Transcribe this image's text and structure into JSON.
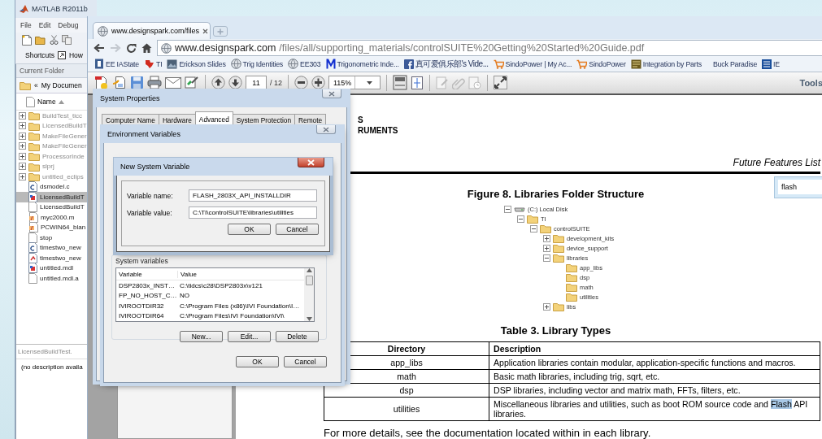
{
  "matlab": {
    "title": "MATLAB R2011b",
    "menu": [
      "File",
      "Edit",
      "Debug"
    ],
    "shortcuts": [
      "Shortcuts",
      "How"
    ],
    "panel_title": "Current Folder",
    "path_prefix": "«",
    "path": "My Documen",
    "name_column": "Name",
    "files": [
      {
        "name": "BuildTest_ticc",
        "kind": "folder",
        "expanded": false,
        "selected": false
      },
      {
        "name": "LicensedBuildT",
        "kind": "folder",
        "expanded": false,
        "selected": false
      },
      {
        "name": "MakeFileGener",
        "kind": "folder",
        "expanded": false,
        "selected": false
      },
      {
        "name": "MakeFileGener",
        "kind": "folder",
        "expanded": false,
        "selected": false
      },
      {
        "name": "ProcessorInde",
        "kind": "folder",
        "expanded": false,
        "selected": false
      },
      {
        "name": "slprj",
        "kind": "folder",
        "expanded": false,
        "selected": false
      },
      {
        "name": "untitled_eclips",
        "kind": "folder",
        "expanded": false,
        "selected": false
      },
      {
        "name": "dsmodel.c",
        "kind": "c",
        "selected": false
      },
      {
        "name": "LicensedBuildT",
        "kind": "model",
        "selected": true
      },
      {
        "name": "LicensedBuildT",
        "kind": "plain",
        "selected": false
      },
      {
        "name": "myc2000.m",
        "kind": "function",
        "selected": false
      },
      {
        "name": "PCWIN64_blan",
        "kind": "function",
        "selected": false
      },
      {
        "name": "stop",
        "kind": "plain",
        "selected": false
      },
      {
        "name": "timestwo_new",
        "kind": "c",
        "selected": false
      },
      {
        "name": "timestwo_new",
        "kind": "mex",
        "selected": false
      },
      {
        "name": "untitled.mdl",
        "kind": "model",
        "selected": false
      },
      {
        "name": "untitled.mdl.a",
        "kind": "plain",
        "selected": false
      }
    ],
    "details_title": "LicensedBuildTest.",
    "details_text": "(no description availa"
  },
  "browser": {
    "tab": {
      "title": "www.designspark.com/files",
      "selected": true
    },
    "address": {
      "domain": "www.designspark.com",
      "path": "/files/all/supporting_materials/controlSUITE%20Getting%20Started%20Guide.pdf"
    },
    "bookmarks": [
      {
        "label": "EE IAState",
        "kind": "site"
      },
      {
        "label": "TI",
        "kind": "ti"
      },
      {
        "label": "Erickson Slides",
        "kind": "photo"
      },
      {
        "label": "Trig Identities",
        "kind": "globe"
      },
      {
        "label": "EE303",
        "kind": "globe"
      },
      {
        "label": "Trigonometric Inde...",
        "kind": "m"
      },
      {
        "label": "真可爱俱乐部's Vide...",
        "kind": "facebook"
      },
      {
        "label": "SindoPower | My Ac...",
        "kind": "cart"
      },
      {
        "label": "SindoPower",
        "kind": "cart"
      },
      {
        "label": "Integration by Parts",
        "kind": "book"
      },
      {
        "label": "Buck Paradise",
        "kind": "none"
      },
      {
        "label": "IE",
        "kind": "ieee"
      }
    ],
    "pdf": {
      "page": "11",
      "page_count": "/ 12",
      "zoom": "115%",
      "tools": "Tools",
      "search": "flash",
      "page_header": [
        "S",
        "RUMENTS"
      ],
      "running_title": "Future Features List",
      "figure_title": "Figure 8. Libraries Folder Structure",
      "tree": [
        {
          "label": "(C:) Local Disk",
          "kind": "drive",
          "expanded": true,
          "children": [
            {
              "label": "TI",
              "kind": "folder",
              "expanded": true,
              "children": [
                {
                  "label": "controlSUITE",
                  "kind": "folder",
                  "expanded": true,
                  "children": [
                    {
                      "label": "development_kits",
                      "kind": "folder",
                      "expanded": false
                    },
                    {
                      "label": "device_support",
                      "kind": "folder",
                      "expanded": false
                    },
                    {
                      "label": "libraries",
                      "kind": "folder",
                      "expanded": true,
                      "children": [
                        {
                          "label": "app_libs",
                          "kind": "folder"
                        },
                        {
                          "label": "dsp",
                          "kind": "folder"
                        },
                        {
                          "label": "math",
                          "kind": "folder"
                        },
                        {
                          "label": "utilities",
                          "kind": "folder"
                        }
                      ]
                    },
                    {
                      "label": "libs",
                      "kind": "folder",
                      "expanded": false
                    }
                  ]
                }
              ]
            }
          ]
        }
      ],
      "table_title": "Table 3. Library Types",
      "table": {
        "columns": [
          "Directory",
          "Description"
        ],
        "rows": [
          {
            "directory": "app_libs",
            "description": "Application libraries contain modular, application-specific functions and macros."
          },
          {
            "directory": "math",
            "description": "Basic math libraries, including trig, sqrt, etc."
          },
          {
            "directory": "dsp",
            "description": "DSP libraries, including vector and matrix math, FFTs, filters, etc."
          },
          {
            "directory": "utilities",
            "description": "Miscellaneous libraries and utilities, such as boot ROM source code and ",
            "highlight": "Flash",
            "description_end": " API libraries."
          }
        ]
      },
      "footer_text": "For more details, see the documentation located within in each library."
    }
  },
  "system_properties": {
    "title": "System Properties",
    "tabs": [
      {
        "label": "Computer Name",
        "selected": false
      },
      {
        "label": "Hardware",
        "selected": false
      },
      {
        "label": "Advanced",
        "selected": true
      },
      {
        "label": "System Protection",
        "selected": false
      },
      {
        "label": "Remote",
        "selected": false
      }
    ]
  },
  "environment_variables": {
    "title": "Environment Variables",
    "group": "System variables",
    "columns": [
      "Variable",
      "Value"
    ],
    "rows": [
      {
        "variable": "DSP2803x_INST…",
        "value": "C:\\tidcs\\c28\\DSP2803x\\v121"
      },
      {
        "variable": "FP_NO_HOST_C…",
        "value": "NO"
      },
      {
        "variable": "IVIROOTDIR32",
        "value": "C:\\Program Files (x86)\\IVI Foundation\\I…"
      },
      {
        "variable": "IVIROOTDIR64",
        "value": "C:\\Program Files\\IVI Foundation\\IVI\\"
      }
    ],
    "list_buttons": [
      "New...",
      "Edit...",
      "Delete"
    ],
    "buttons": [
      "OK",
      "Cancel"
    ]
  },
  "new_variable": {
    "title": "New System Variable",
    "name_label": "Variable name:",
    "name_value": "FLASH_2803X_API_INSTALLDIR",
    "value_label": "Variable value:",
    "value_value": "C:\\TI\\controlSUITE\\libraries\\utilities",
    "buttons": [
      "OK",
      "Cancel"
    ]
  }
}
